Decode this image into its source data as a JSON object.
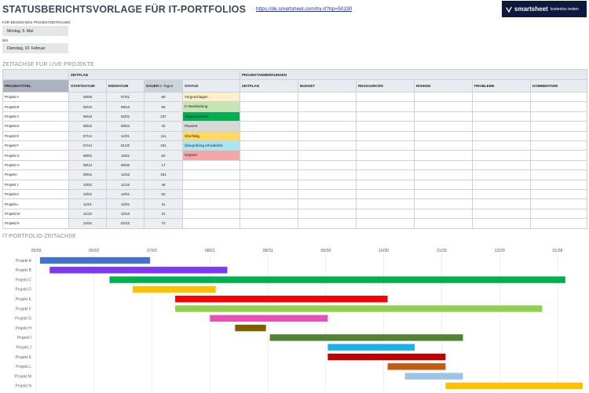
{
  "header": {
    "title": "STATUSBERICHTSVORLAGE FÜR IT-PORTFOLIOS",
    "link": "https://de.smartsheet.com/try-it?trp=50190",
    "brand_name": "smartsheet",
    "brand_cta": "kostenlos testen"
  },
  "dates": {
    "start_label": "FÜR BEGINN DES PROJEKTZEITRAUMS",
    "start_value": "Montag, 5. Mai",
    "end_label": "BIS",
    "end_value": "Dienstag, 10. Februar"
  },
  "sections": {
    "live": "ZEITACHSE FÜR LIVE-PROJEKTE",
    "portfolio": "IT-PORTFOLIO-ZEITACHSE"
  },
  "table": {
    "group_time": "ZEITPLAN",
    "group_notes": "PROJEKTANMERKUNGEN",
    "col_title": "PROJEKTTITEL",
    "col_start": "STARTDATUM",
    "col_end": "ENDDATUM",
    "col_duration": "DAUER",
    "col_duration_unit": "in Tagen",
    "col_status": "STATUS",
    "notes_cols": [
      "ZEITPLAN",
      "BUDGET",
      "RESSOURCEN",
      "RISIKEN",
      "PROBLEME",
      "KOMMENTARE"
    ],
    "rows": [
      {
        "title": "Projekt A",
        "start": "05/05",
        "end": "07/01",
        "duration": "58",
        "status": "Vorgeschlagen",
        "status_color": "#fdf0c8"
      },
      {
        "title": "Projekt B",
        "start": "05/10",
        "end": "08/10",
        "duration": "93",
        "status": "In Bearbeitung",
        "status_color": "#c8e3b4"
      },
      {
        "title": "Projekt C",
        "start": "06/10",
        "end": "02/01",
        "duration": "237",
        "status": "Abgeschlossen",
        "status_color": "#00b050"
      },
      {
        "title": "Projekt D",
        "start": "06/22",
        "end": "08/04",
        "duration": "44",
        "status": "Pausiert",
        "status_color": "#d9d9d9"
      },
      {
        "title": "Projekt E",
        "start": "07/14",
        "end": "11/01",
        "duration": "111",
        "status": "Überfällig",
        "status_color": "#ffd966"
      },
      {
        "title": "Projekt F",
        "start": "07/14",
        "end": "01/20",
        "duration": "191",
        "status": "Überprüfung erforderlich",
        "status_color": "#a7e6f7"
      },
      {
        "title": "Projekt G",
        "start": "08/01",
        "end": "10/01",
        "duration": "62",
        "status": "Geplant",
        "status_color": "#f4a7a7"
      },
      {
        "title": "Projekt H",
        "start": "08/14",
        "end": "08/30",
        "duration": "17",
        "status": "",
        "status_color": ""
      },
      {
        "title": "Projekt I",
        "start": "09/01",
        "end": "12/10",
        "duration": "101",
        "status": "",
        "status_color": ""
      },
      {
        "title": "Projekt J",
        "start": "10/01",
        "end": "11/15",
        "duration": "46",
        "status": "",
        "status_color": ""
      },
      {
        "title": "Projekt K",
        "start": "10/01",
        "end": "12/01",
        "duration": "62",
        "status": "",
        "status_color": ""
      },
      {
        "title": "Projekt L",
        "start": "11/01",
        "end": "12/01",
        "duration": "31",
        "status": "",
        "status_color": ""
      },
      {
        "title": "Projekt M",
        "start": "11/10",
        "end": "12/10",
        "duration": "31",
        "status": "",
        "status_color": ""
      },
      {
        "title": "Projekt N",
        "start": "12/01",
        "end": "02/10",
        "duration": "72",
        "status": "",
        "status_color": ""
      }
    ]
  },
  "chart_data": {
    "type": "bar",
    "orientation": "horizontal-gantt",
    "x_ticks": [
      "05/03",
      "06/02",
      "07/02",
      "08/01",
      "08/31",
      "09/30",
      "10/30",
      "11/29",
      "12/29",
      "01/28"
    ],
    "x_range": [
      "05/03",
      "02/10"
    ],
    "grid": true,
    "bars": [
      {
        "category": "Projekt A",
        "start": "05/05",
        "end": "07/01",
        "color": "#4472c4"
      },
      {
        "category": "Projekt B",
        "start": "05/10",
        "end": "08/10",
        "color": "#7c3aed"
      },
      {
        "category": "Projekt C",
        "start": "06/10",
        "end": "02/01",
        "color": "#00b050"
      },
      {
        "category": "Projekt D",
        "start": "06/22",
        "end": "08/04",
        "color": "#ffc000"
      },
      {
        "category": "Projekt E",
        "start": "07/14",
        "end": "11/01",
        "color": "#ff0000"
      },
      {
        "category": "Projekt F",
        "start": "07/14",
        "end": "01/20",
        "color": "#92d050"
      },
      {
        "category": "Projekt G",
        "start": "08/01",
        "end": "10/01",
        "color": "#e94fb5"
      },
      {
        "category": "Projekt H",
        "start": "08/14",
        "end": "08/30",
        "color": "#7f6000"
      },
      {
        "category": "Projekt I",
        "start": "09/01",
        "end": "12/10",
        "color": "#548235"
      },
      {
        "category": "Projekt J",
        "start": "10/01",
        "end": "11/15",
        "color": "#1cb0e8"
      },
      {
        "category": "Projekt K",
        "start": "10/01",
        "end": "12/01",
        "color": "#c00000"
      },
      {
        "category": "Projekt L",
        "start": "11/01",
        "end": "12/01",
        "color": "#c55a11"
      },
      {
        "category": "Projekt M",
        "start": "11/10",
        "end": "12/10",
        "color": "#9dc3e6"
      },
      {
        "category": "Projekt N",
        "start": "12/01",
        "end": "02/10",
        "color": "#ffc000"
      }
    ]
  }
}
